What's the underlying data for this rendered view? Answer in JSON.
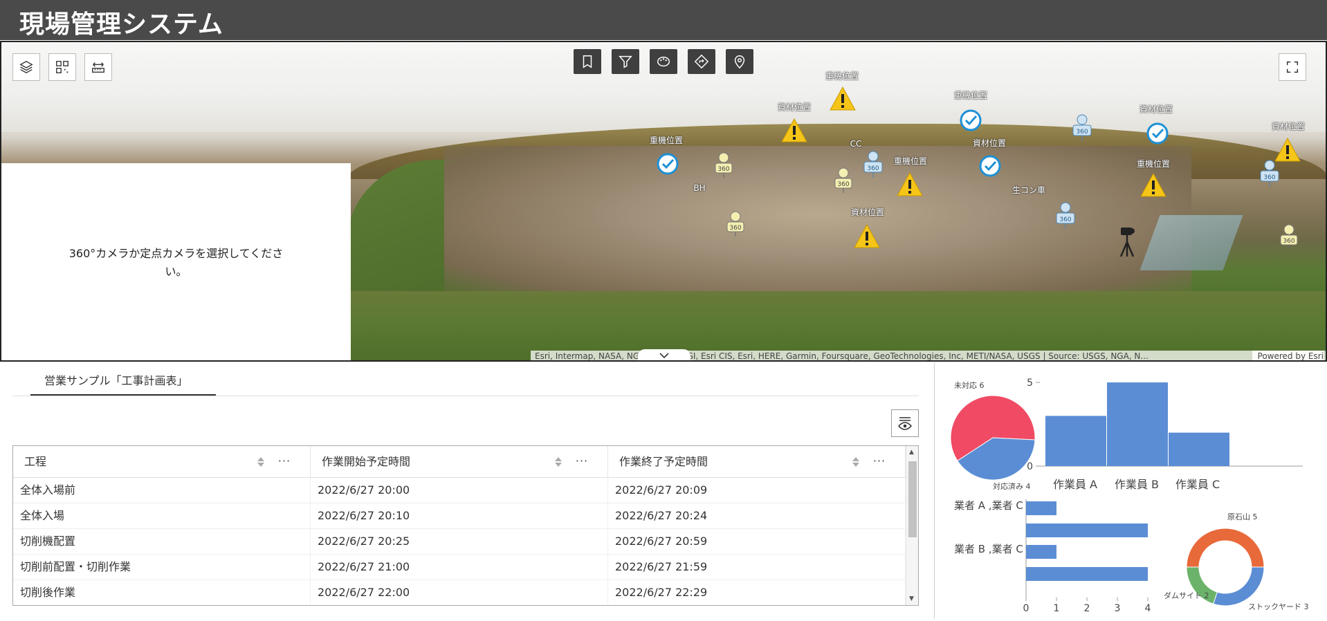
{
  "app": {
    "title": "現場管理システム"
  },
  "map": {
    "left_tools": [
      "layers-icon",
      "qr-icon",
      "measure-icon"
    ],
    "top_tools": [
      "bookmark-icon",
      "filter-icon",
      "style-icon",
      "directions-icon",
      "location-pin-icon"
    ],
    "fullscreen_icon": "fullscreen-icon",
    "camera_message": "360°カメラか定点カメラを選択してください。",
    "attribution": "Esri, Intermap, NASA, NGA, USGS | GSI, Esri CIS, Esri, HERE, Garmin, Foursquare, GeoTechnologies, Inc, METI/NASA, USGS | Source: USGS, NGA, N...",
    "powered_by": "Powered by Esri",
    "labels": {
      "heavy1": "重機位置",
      "heavy2": "重機位置",
      "heavy3": "重機位置",
      "heavy4": "重機位置",
      "heavy5": "重機位置",
      "mat1": "資材位置",
      "mat2": "資材位置",
      "mat3": "資材位置",
      "mat4": "資材位置",
      "mat5": "資材位置",
      "cc": "CC",
      "bh": "BH",
      "truck": "生コン車"
    },
    "warning_color": "#f5c518",
    "check_color": "#1e90d6"
  },
  "tab": {
    "label": "営業サンプル「工事計画表」"
  },
  "table": {
    "columns": [
      "工程",
      "作業開始予定時間",
      "作業終了予定時間"
    ],
    "rows": [
      [
        "全体入場前",
        "2022/6/27 20:00",
        "2022/6/27 20:09"
      ],
      [
        "全体入場",
        "2022/6/27 20:10",
        "2022/6/27 20:24"
      ],
      [
        "切削機配置",
        "2022/6/27 20:25",
        "2022/6/27 20:59"
      ],
      [
        "切削前配置・切削作業",
        "2022/6/27 21:00",
        "2022/6/27 21:59"
      ],
      [
        "切削後作業",
        "2022/6/27 22:00",
        "2022/6/27 22:29"
      ]
    ],
    "more": "···"
  },
  "chart_data": [
    {
      "type": "pie",
      "labels": [
        "未対応",
        "対応済み"
      ],
      "values": [
        6,
        4
      ],
      "label_text": [
        "未対応 6",
        "対応済み 4"
      ],
      "colors": [
        "#f04a64",
        "#5b8dd4"
      ]
    },
    {
      "type": "bar",
      "categories": [
        "作業員 A",
        "作業員 B",
        "作業員 C"
      ],
      "values": [
        3,
        5,
        2
      ],
      "y_ticks": [
        "5",
        "0"
      ],
      "ylim": [
        0,
        5
      ],
      "color": "#5b8dd4"
    },
    {
      "type": "bar",
      "orientation": "horizontal",
      "category_labels": [
        "業者 A ,業者 C",
        "業者 B ,業者 C"
      ],
      "values": [
        1,
        4,
        1,
        4
      ],
      "x_ticks": [
        "0",
        "1",
        "2",
        "3",
        "4"
      ],
      "xlim": [
        0,
        4
      ],
      "color": "#5b8dd4"
    },
    {
      "type": "pie",
      "donut": true,
      "labels": [
        "原石山",
        "ストックヤード",
        "ダムサイト"
      ],
      "values": [
        5,
        3,
        2
      ],
      "label_text": [
        "原石山 5",
        "ストックヤード 3",
        "ダムサイト 2"
      ],
      "colors": [
        "#e8693a",
        "#5b8dd4",
        "#6bb36b"
      ]
    }
  ]
}
